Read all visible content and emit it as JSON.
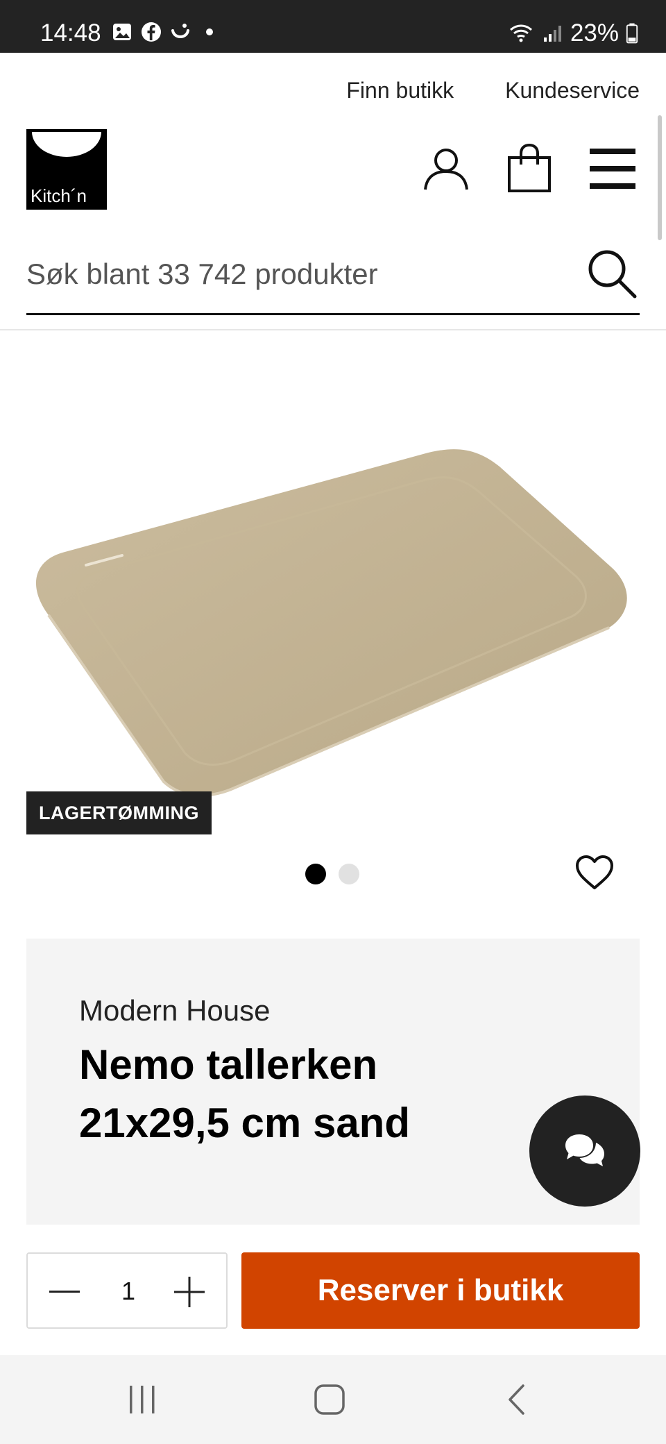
{
  "status_bar": {
    "time": "14:48",
    "battery": "23%",
    "icons": [
      "gallery-icon",
      "facebook-icon",
      "smile-icon",
      "dot-icon",
      "wifi-icon",
      "signal-icon",
      "battery-icon"
    ]
  },
  "header": {
    "links": [
      "Finn butikk",
      "Kundeservice"
    ],
    "logo_text": "Kitch´n",
    "icons": [
      "user-icon",
      "shopping-bag-icon",
      "menu-icon"
    ]
  },
  "search": {
    "placeholder": "Søk blant 33 742 produkter"
  },
  "product": {
    "badge": "LAGERTØMMING",
    "brand": "Modern House",
    "title": "Nemo tallerken 21x29,5 cm sand",
    "image_color": "#c2b293",
    "carousel": {
      "total": 2,
      "active": 1
    }
  },
  "purchase": {
    "quantity": "1",
    "reserve_label": "Reserver i butikk",
    "accent_color": "#d14400"
  },
  "navbar": {
    "icons": [
      "recent-apps-icon",
      "home-icon",
      "back-icon"
    ]
  }
}
